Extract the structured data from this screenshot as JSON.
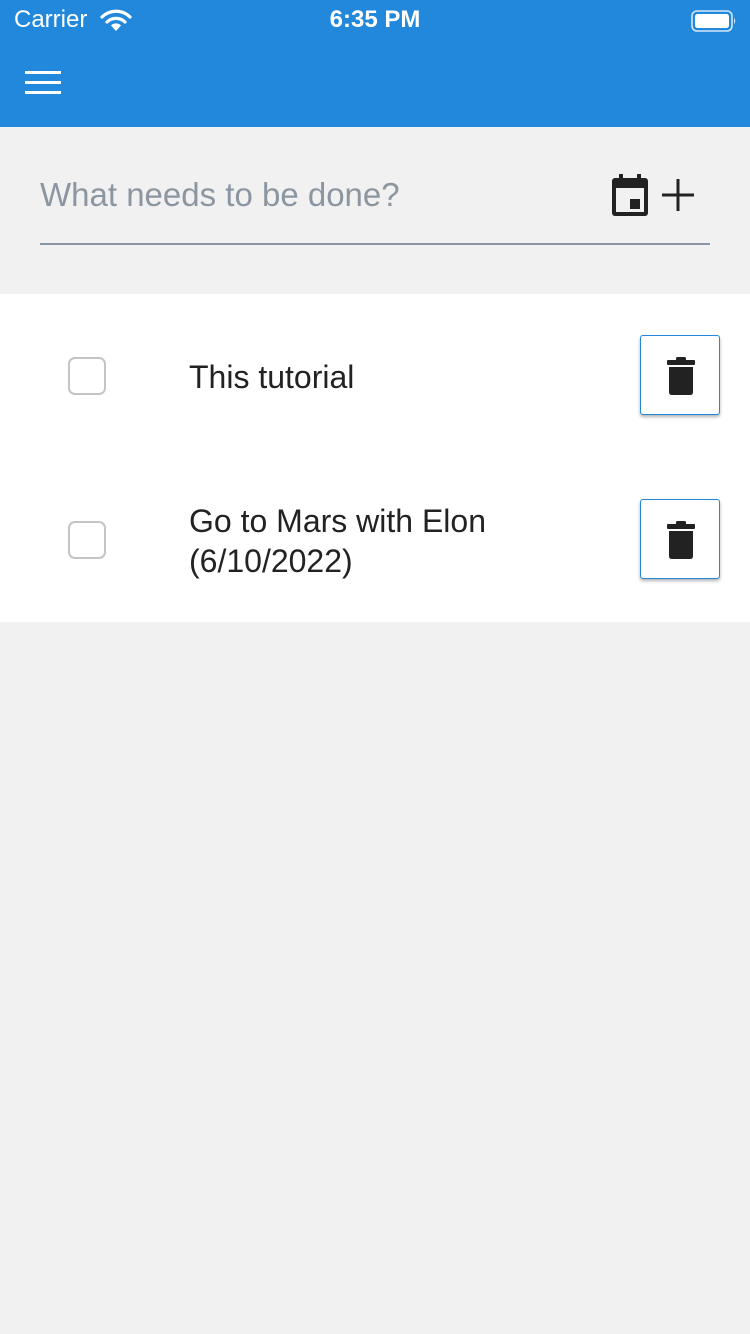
{
  "status_bar": {
    "carrier": "Carrier",
    "time": "6:35 PM"
  },
  "header": {
    "background_color": "#2288dc",
    "menu_icon": "hamburger-menu-icon"
  },
  "add_todo": {
    "placeholder": "What needs to be done?",
    "value": "",
    "calendar_icon": "calendar-icon",
    "add_icon": "plus-icon"
  },
  "todos": [
    {
      "label": "This tutorial",
      "checked": false,
      "delete_icon": "trash-icon"
    },
    {
      "label": "Go to Mars with Elon (6/10/2022)",
      "checked": false,
      "delete_icon": "trash-icon"
    }
  ],
  "colors": {
    "accent": "#2288dc",
    "background": "#f1f1f1",
    "list_background": "#ffffff",
    "text": "#222222",
    "placeholder": "#8c96a0"
  }
}
